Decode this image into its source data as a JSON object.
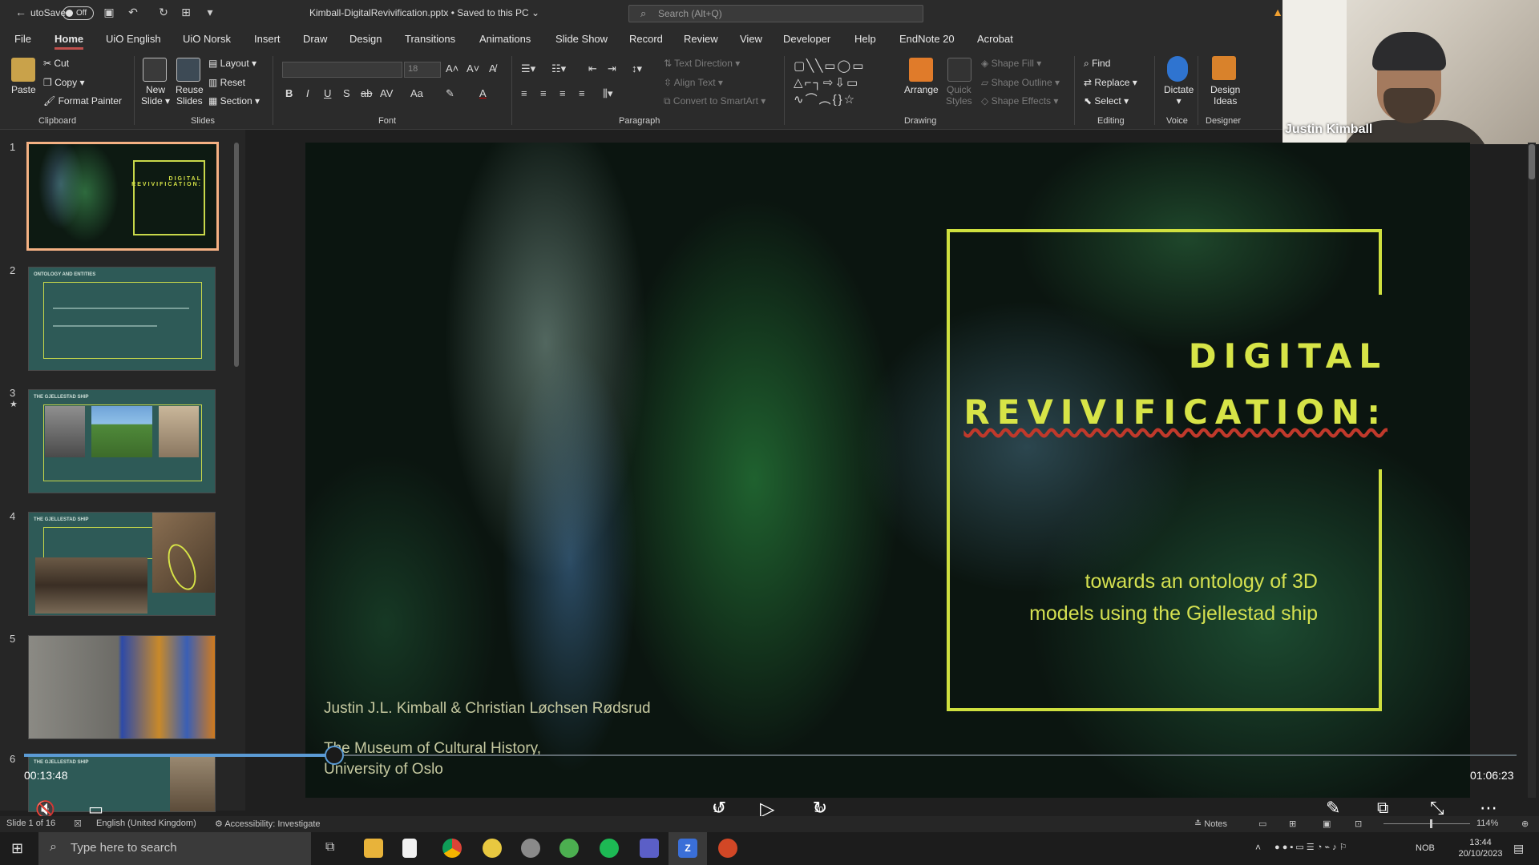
{
  "titlebar": {
    "autosave_label": "utoSave",
    "autosave_state": "Off",
    "document_title": "Kimball-DigitalRevivification.pptx • Saved to this PC",
    "search_placeholder": "Search (Alt+Q)"
  },
  "menu": [
    "File",
    "Home",
    "UiO English",
    "UiO Norsk",
    "Insert",
    "Draw",
    "Design",
    "Transitions",
    "Animations",
    "Slide Show",
    "Record",
    "Review",
    "View",
    "Developer",
    "Help",
    "EndNote 20",
    "Acrobat"
  ],
  "ribbon": {
    "clipboard": {
      "paste": "Paste",
      "cut": "Cut",
      "copy": "Copy",
      "format_painter": "Format Painter",
      "group": "Clipboard"
    },
    "slides": {
      "new_slide": "New Slide",
      "new_slide_1": "New",
      "new_slide_2": "Slide",
      "reuse_1": "Reuse",
      "reuse_2": "Slides",
      "layout": "Layout",
      "reset": "Reset",
      "section": "Section",
      "group": "Slides"
    },
    "font": {
      "size": "18",
      "group": "Font"
    },
    "paragraph": {
      "text_direction": "Text Direction",
      "align_text": "Align Text",
      "convert_smartart": "Convert to SmartArt",
      "group": "Paragraph"
    },
    "drawing": {
      "arrange": "Arrange",
      "quick_styles_1": "Quick",
      "quick_styles_2": "Styles",
      "shape_fill": "Shape Fill",
      "shape_outline": "Shape Outline",
      "shape_effects": "Shape Effects",
      "group": "Drawing"
    },
    "editing": {
      "find": "Find",
      "replace": "Replace",
      "select": "Select",
      "group": "Editing"
    },
    "voice": {
      "dictate": "Dictate",
      "group": "Voice"
    },
    "designer": {
      "design_ideas_1": "Design",
      "design_ideas_2": "Ideas",
      "group": "Designer"
    }
  },
  "webcam": {
    "participant_name": "Justin Kimball"
  },
  "thumbnails": {
    "numbers": [
      "1",
      "2",
      "3",
      "4",
      "5",
      "6"
    ],
    "t1_title_1": "DIGITAL",
    "t1_title_2": "REVIVIFICATION:",
    "t2_heading": "ONTOLOGY AND ENTITIES",
    "t3_heading": "THE GJELLESTAD SHIP",
    "t4_heading": "THE GJELLESTAD SHIP",
    "t6_heading": "THE GJELLESTAD SHIP"
  },
  "slide": {
    "title_line1": "DIGITAL",
    "title_line2": "REVIVIFICATION:",
    "subtitle": "towards an ontology of 3D models using the Gjellestad ship",
    "authors": "Justin J.L. Kimball & Christian Løchsen Rødsrud",
    "institution_line1": "The Museum of Cultural History,",
    "institution_line2": "University of Oslo"
  },
  "player": {
    "elapsed": "00:13:48",
    "duration": "01:06:23",
    "progress_fraction": 0.208,
    "rewind_label": "10",
    "forward_label": "30"
  },
  "status": {
    "slide_of": "Slide 1 of 16",
    "language": "English (United Kingdom)",
    "accessibility": "Accessibility: Investigate",
    "notes": "Notes",
    "zoom": "114%"
  },
  "taskbar": {
    "search_placeholder": "Type here to search",
    "language_indicator": "NOB",
    "time": "13:44",
    "date": "20/10/2023"
  },
  "colors": {
    "accent_title": "#d7e447",
    "frame": "#cfe03f",
    "selection": "#f4b183",
    "progress": "#5b9bd5"
  }
}
